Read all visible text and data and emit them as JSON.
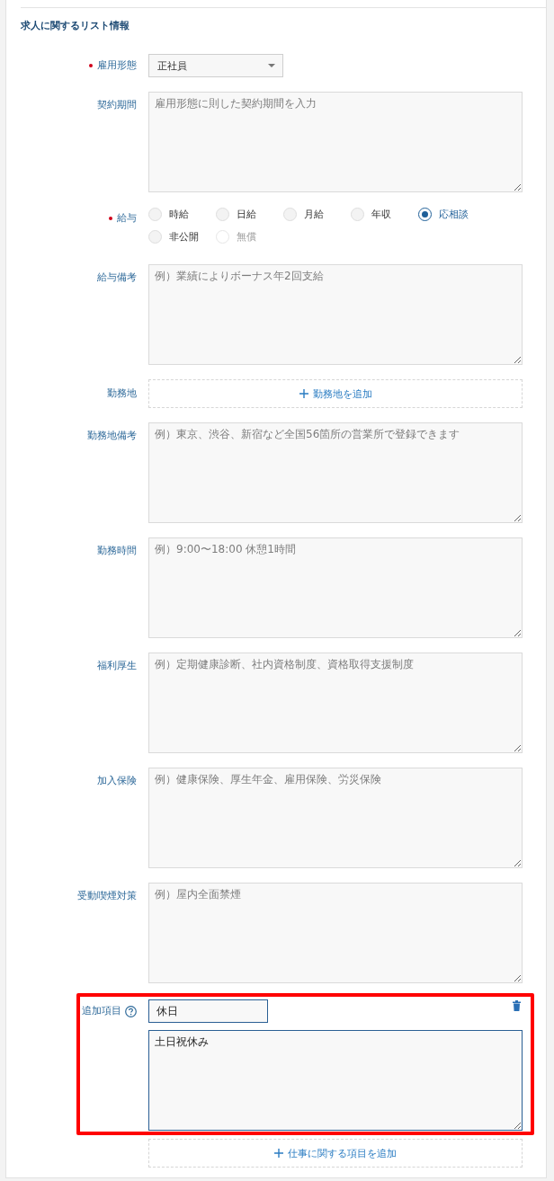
{
  "section": {
    "title": "求人に関するリスト情報"
  },
  "fields": [
    {
      "kind": "select",
      "label": "雇用形態",
      "required": true,
      "value": "正社員"
    },
    {
      "kind": "textarea",
      "label": "契約期間",
      "required": false,
      "placeholder": "雇用形態に則した契約期間を入力"
    },
    {
      "kind": "radio",
      "label": "給与",
      "required": true,
      "options": [
        {
          "label": "時給",
          "selected": false,
          "disabled": false
        },
        {
          "label": "日給",
          "selected": false,
          "disabled": false
        },
        {
          "label": "月給",
          "selected": false,
          "disabled": false
        },
        {
          "label": "年収",
          "selected": false,
          "disabled": false
        },
        {
          "label": "応相談",
          "selected": true,
          "disabled": false
        },
        {
          "label": "非公開",
          "selected": false,
          "disabled": false
        },
        {
          "label": "無償",
          "selected": false,
          "disabled": true
        }
      ]
    },
    {
      "kind": "textarea",
      "label": "給与備考",
      "required": false,
      "placeholder": "例）業績によりボーナス年2回支給"
    },
    {
      "kind": "add",
      "label": "勤務地",
      "required": false,
      "button": "勤務地を追加"
    },
    {
      "kind": "textarea",
      "label": "勤務地備考",
      "required": false,
      "placeholder": "例）東京、渋谷、新宿など全国56箇所の営業所で登録できます"
    },
    {
      "kind": "textarea",
      "label": "勤務時間",
      "required": false,
      "placeholder": "例）9:00〜18:00 休憩1時間"
    },
    {
      "kind": "textarea",
      "label": "福利厚生",
      "required": false,
      "placeholder": "例）定期健康診断、社内資格制度、資格取得支援制度"
    },
    {
      "kind": "textarea",
      "label": "加入保険",
      "required": false,
      "placeholder": "例）健康保険、厚生年金、雇用保険、労災保険"
    },
    {
      "kind": "textarea",
      "label": "受動喫煙対策",
      "required": false,
      "placeholder": "例）屋内全面禁煙"
    }
  ],
  "custom_items": [
    {
      "label": "追加項目",
      "title_value": "休日",
      "value": "土日祝休み",
      "highlighted": true
    }
  ],
  "add_custom_button": {
    "label": "仕事に関する項目を追加"
  }
}
